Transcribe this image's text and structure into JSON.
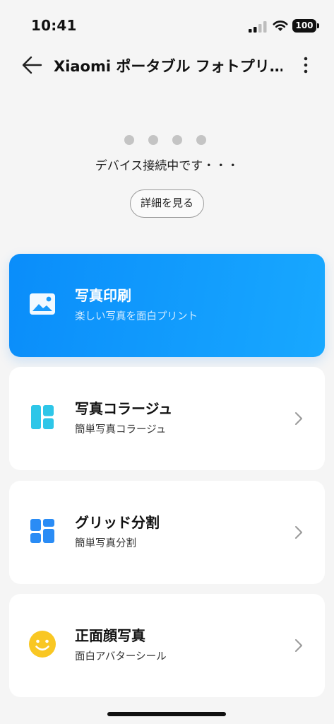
{
  "status_bar": {
    "time": "10:41",
    "battery": "100"
  },
  "header": {
    "title": "Xiaomi ポータブル フォトプリ…",
    "back_icon": "arrow-left-icon",
    "more_icon": "more-vertical-icon"
  },
  "connection": {
    "status_text": "デバイス接続中です・・・",
    "details_label": "詳細を見る"
  },
  "cards": [
    {
      "title": "写真印刷",
      "subtitle": "楽しい写真を面白プリント",
      "icon": "image-icon",
      "highlighted": true
    },
    {
      "title": "写真コラージュ",
      "subtitle": "簡単写真コラージュ",
      "icon": "collage-icon"
    },
    {
      "title": "グリッド分割",
      "subtitle": "簡単写真分割",
      "icon": "grid-icon"
    },
    {
      "title": "正面顔写真",
      "subtitle": "面白アバターシール",
      "icon": "smiley-icon"
    }
  ],
  "colors": {
    "accent": "#0a8dfa",
    "collage_icon": "#2ec6e8",
    "grid_icon": "#2a8cf5",
    "smiley_icon": "#f9c723"
  }
}
